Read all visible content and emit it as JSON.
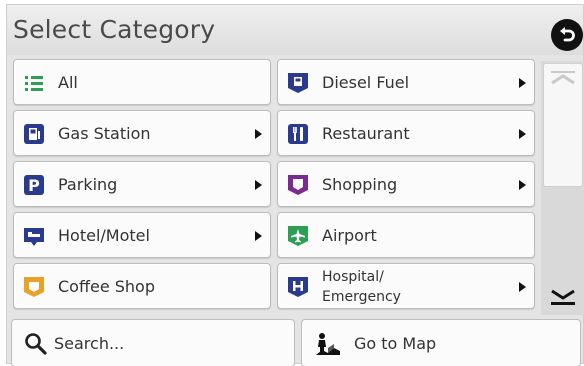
{
  "header": {
    "title": "Select Category"
  },
  "categories_left": [
    {
      "label": "All",
      "icon": "list-icon"
    },
    {
      "label": "Gas Station",
      "icon": "gas-station-icon"
    },
    {
      "label": "Parking",
      "icon": "parking-icon"
    },
    {
      "label": "Hotel/Motel",
      "icon": "hotel-icon"
    },
    {
      "label": "Coffee Shop",
      "icon": "coffee-cup-icon"
    }
  ],
  "categories_right": [
    {
      "label": "Diesel Fuel",
      "icon": "diesel-fuel-icon"
    },
    {
      "label": "Restaurant",
      "icon": "restaurant-icon"
    },
    {
      "label": "Shopping",
      "icon": "shopping-icon"
    },
    {
      "label": "Airport",
      "icon": "airplane-icon"
    },
    {
      "label_line1": "Hospital/",
      "label_line2": "Emergency",
      "icon": "hospital-icon"
    }
  ],
  "footer": {
    "search_label": "Search...",
    "map_label": "Go to Map"
  },
  "colors": {
    "green": "#2e9e55",
    "navy": "#2a3a8c",
    "purple": "#7b2b8f",
    "orange": "#e8a12a"
  }
}
